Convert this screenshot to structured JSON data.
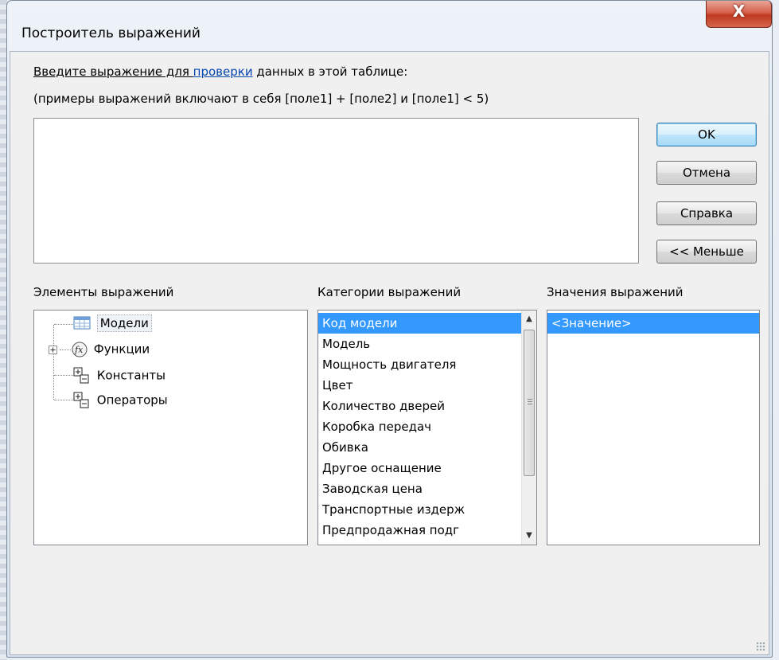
{
  "window": {
    "title": "Построитель выражений",
    "close_glyph": "X"
  },
  "prompt": {
    "line1_prefix": "Введите выражение для ",
    "line1_link": "проверки",
    "line1_suffix": " данных в этой таблице:",
    "line2": "(примеры выражений включают в себя [поле1] + [поле2] и [поле1] < 5)"
  },
  "expression": {
    "value": ""
  },
  "buttons": {
    "ok": "OK",
    "cancel": "Отмена",
    "help": "Справка",
    "less": "<< Меньше"
  },
  "panels": {
    "elements": {
      "label": "Элементы выражений",
      "items": [
        "Модели",
        "Функции",
        "Константы",
        "Операторы"
      ]
    },
    "categories": {
      "label": "Категории выражений",
      "items": [
        "Код модели",
        "Модель",
        "Мощность двигателя",
        "Цвет",
        "Количество дверей",
        "Коробка передач",
        "Обивка",
        "Другое оснащение",
        "Заводская цена",
        "Транспортные издерж",
        "Предпродажная подг"
      ],
      "selected_index": 0
    },
    "values": {
      "label": "Значения выражений",
      "items": [
        "<Значение>"
      ],
      "selected_index": 0
    }
  },
  "colors": {
    "selection": "#3399ff",
    "link": "#0645ad",
    "close": "#c03a20"
  }
}
